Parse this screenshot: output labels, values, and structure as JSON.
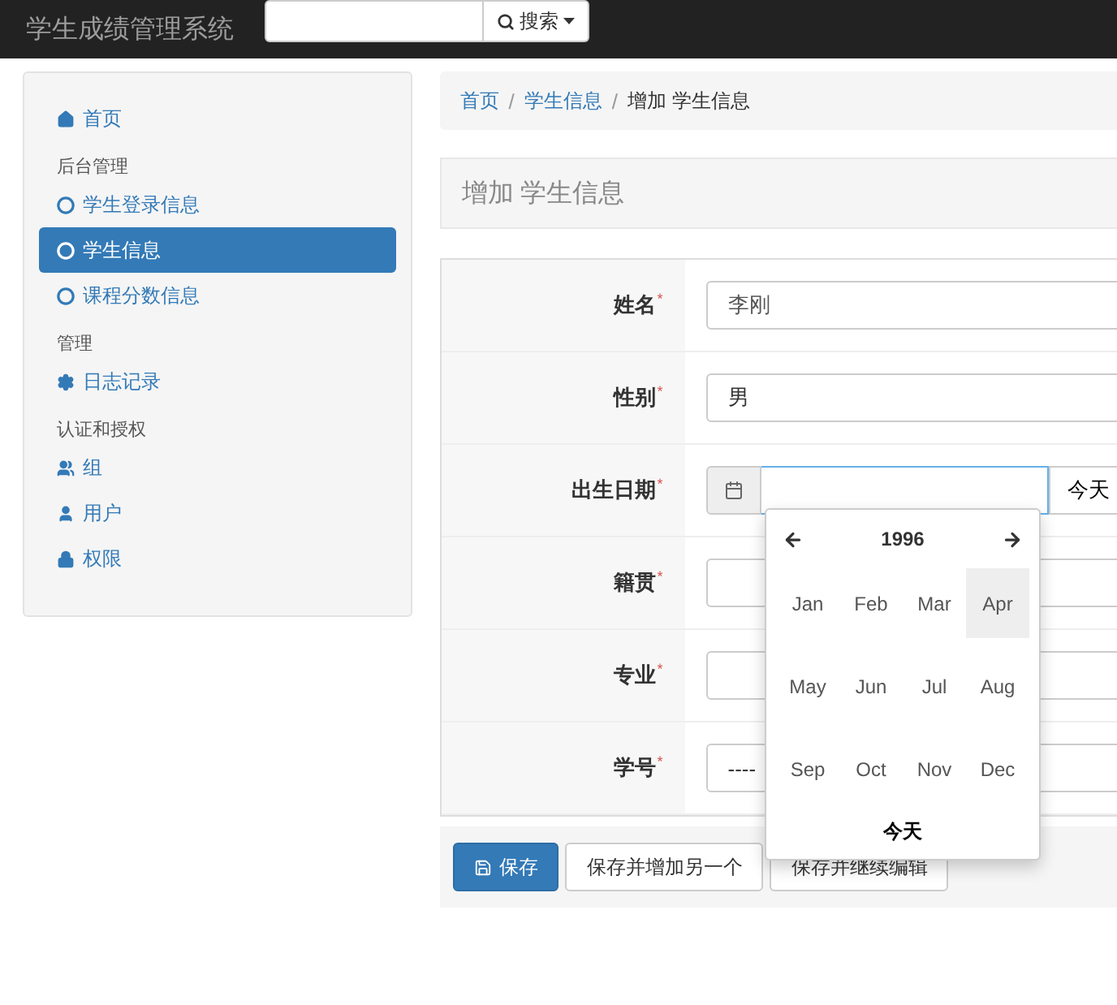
{
  "navbar": {
    "brand": "学生成绩管理系统",
    "search_button": "搜索"
  },
  "sidebar": {
    "items": [
      {
        "kind": "link",
        "label": "首页",
        "selected": false
      },
      {
        "kind": "header",
        "label": "后台管理"
      },
      {
        "kind": "link",
        "label": "学生登录信息",
        "selected": false
      },
      {
        "kind": "link",
        "label": "学生信息",
        "selected": true
      },
      {
        "kind": "link",
        "label": "课程分数信息",
        "selected": false
      },
      {
        "kind": "header",
        "label": "管理"
      },
      {
        "kind": "link",
        "label": "日志记录",
        "selected": false
      },
      {
        "kind": "header",
        "label": "认证和授权"
      },
      {
        "kind": "link",
        "label": "组",
        "selected": false
      },
      {
        "kind": "link",
        "label": "用户",
        "selected": false
      },
      {
        "kind": "link",
        "label": "权限",
        "selected": false
      }
    ]
  },
  "breadcrumb": {
    "separator": "/",
    "items": [
      "首页",
      "学生信息",
      "增加 学生信息"
    ]
  },
  "page_title": "增加 学生信息",
  "form": {
    "required_mark": "*",
    "fields": [
      {
        "kind": "text",
        "label": "姓名",
        "required": true,
        "value": "李刚"
      },
      {
        "kind": "select",
        "label": "性别",
        "required": true,
        "value": "男"
      },
      {
        "kind": "date",
        "label": "出生日期",
        "required": true,
        "today_button": "今天"
      },
      {
        "kind": "text",
        "label": "籍贯",
        "required": true
      },
      {
        "kind": "text",
        "label": "专业",
        "required": true
      },
      {
        "kind": "select",
        "label": "学号",
        "required": true,
        "value": "----"
      }
    ]
  },
  "datepicker": {
    "year": "1996",
    "months": [
      {
        "label": "Jan",
        "highlighted": false
      },
      {
        "label": "Feb",
        "highlighted": false
      },
      {
        "label": "Mar",
        "highlighted": false
      },
      {
        "label": "Apr",
        "highlighted": true
      },
      {
        "label": "May",
        "highlighted": false
      },
      {
        "label": "Jun",
        "highlighted": false
      },
      {
        "label": "Jul",
        "highlighted": false
      },
      {
        "label": "Aug",
        "highlighted": false
      },
      {
        "label": "Sep",
        "highlighted": false
      },
      {
        "label": "Oct",
        "highlighted": false
      },
      {
        "label": "Nov",
        "highlighted": false
      },
      {
        "label": "Dec",
        "highlighted": false
      }
    ],
    "today": "今天"
  },
  "buttons": [
    {
      "kind": "primary",
      "label": "保存"
    },
    {
      "kind": "default",
      "label": "保存并增加另一个"
    },
    {
      "kind": "default",
      "label": "保存并继续编辑"
    }
  ]
}
